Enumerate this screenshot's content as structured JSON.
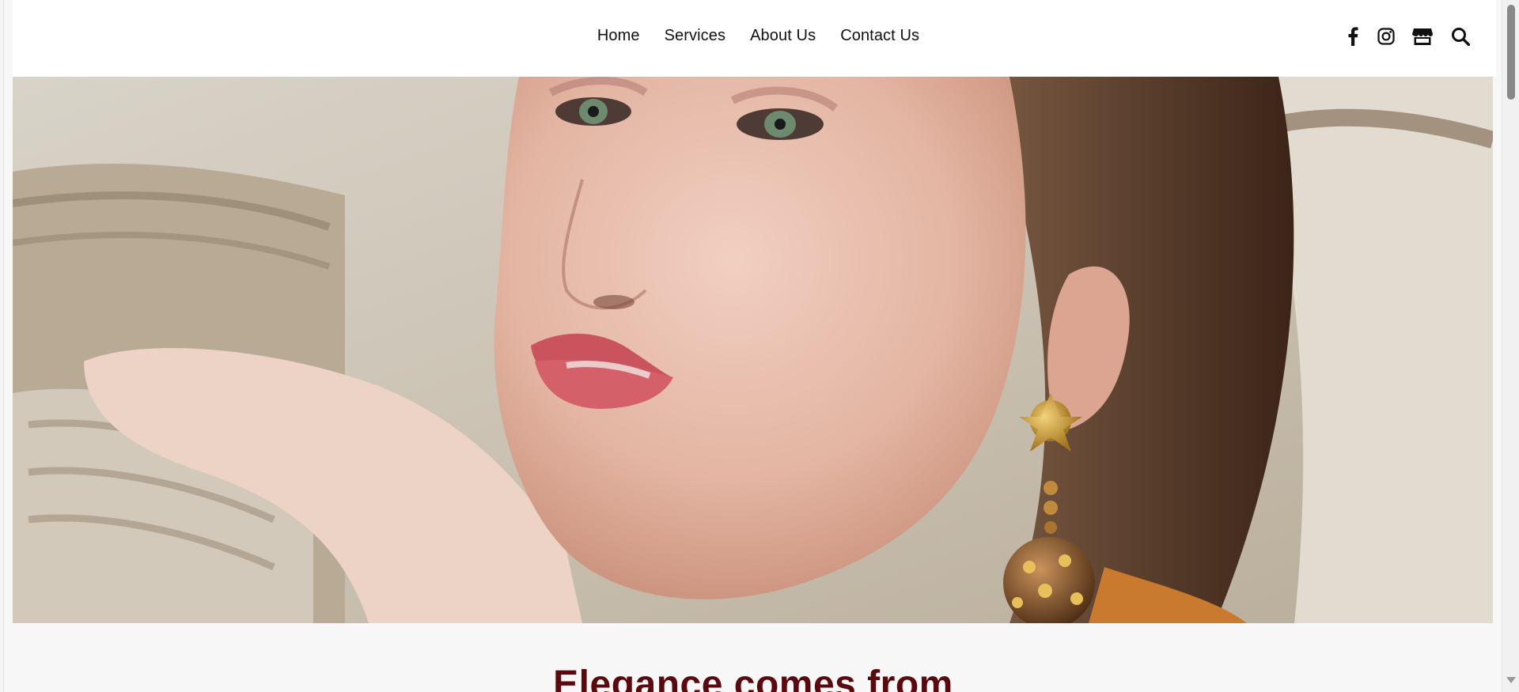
{
  "nav": {
    "items": [
      {
        "label": "Home"
      },
      {
        "label": "Services"
      },
      {
        "label": "About Us"
      },
      {
        "label": "Contact Us"
      }
    ]
  },
  "social": {
    "icons": [
      "facebook-icon",
      "instagram-icon",
      "store-icon",
      "search-icon"
    ]
  },
  "headline": "Elegance comes from",
  "colors": {
    "headline": "#5a0a0e",
    "nav_text": "#111111",
    "header_bg": "#ffffff",
    "page_bg": "#f7f7f7"
  }
}
